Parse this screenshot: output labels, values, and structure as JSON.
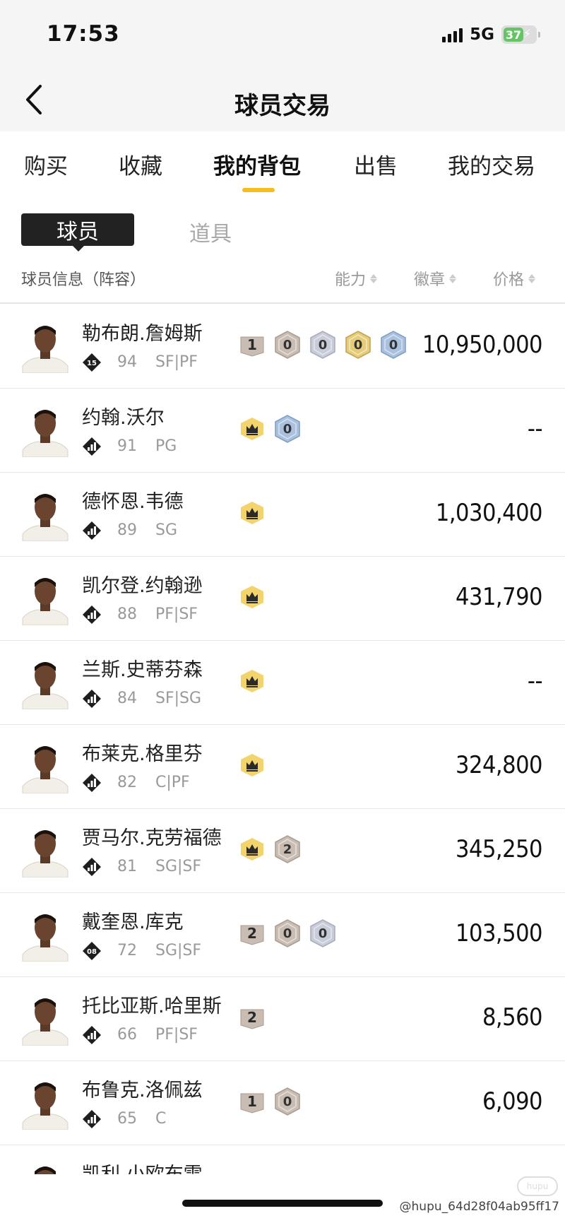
{
  "status_bar": {
    "time": "17:53",
    "network": "5G",
    "battery": "37"
  },
  "header": {
    "title": "球员交易"
  },
  "tabs": [
    {
      "label": "购买",
      "active": false
    },
    {
      "label": "收藏",
      "active": false
    },
    {
      "label": "我的背包",
      "active": true
    },
    {
      "label": "出售",
      "active": false
    },
    {
      "label": "我的交易",
      "active": false
    }
  ],
  "subtabs": {
    "player": "球员",
    "item": "道具"
  },
  "columns": {
    "info": "球员信息（阵容）",
    "ability": "能力",
    "badge": "徽章",
    "price": "价格"
  },
  "colors": {
    "accent": "#f5bd1f",
    "crown": "#f3d36b",
    "badge_tan": "#c9bcb2",
    "badge_silver": "#c8ccd8",
    "badge_gold": "#e4cc7a",
    "badge_blue": "#a9c1de"
  },
  "players": [
    {
      "name": "勒布朗.詹姆斯",
      "tier": "15",
      "ovr": "94",
      "pos": "SF|PF",
      "price": "10,950,000",
      "badges": [
        {
          "type": "square",
          "label": "1"
        },
        {
          "type": "tan",
          "label": "0"
        },
        {
          "type": "silver",
          "label": "0"
        },
        {
          "type": "gold",
          "label": "0"
        },
        {
          "type": "blue",
          "label": "0"
        }
      ]
    },
    {
      "name": "约翰.沃尔",
      "tier": "bars",
      "ovr": "91",
      "pos": "PG",
      "price": "--",
      "badges": [
        {
          "type": "crown",
          "label": ""
        },
        {
          "type": "blue",
          "label": "0"
        }
      ]
    },
    {
      "name": "德怀恩.韦德",
      "tier": "bars",
      "ovr": "89",
      "pos": "SG",
      "price": "1,030,400",
      "badges": [
        {
          "type": "crown",
          "label": ""
        }
      ]
    },
    {
      "name": "凯尔登.约翰逊",
      "tier": "bars",
      "ovr": "88",
      "pos": "PF|SF",
      "price": "431,790",
      "badges": [
        {
          "type": "crown",
          "label": ""
        }
      ]
    },
    {
      "name": "兰斯.史蒂芬森",
      "tier": "bars",
      "ovr": "84",
      "pos": "SF|SG",
      "price": "--",
      "badges": [
        {
          "type": "crown",
          "label": ""
        }
      ]
    },
    {
      "name": "布莱克.格里芬",
      "tier": "bars",
      "ovr": "82",
      "pos": "C|PF",
      "price": "324,800",
      "badges": [
        {
          "type": "crown",
          "label": ""
        }
      ]
    },
    {
      "name": "贾马尔.克劳福德",
      "tier": "bars",
      "ovr": "81",
      "pos": "SG|SF",
      "price": "345,250",
      "badges": [
        {
          "type": "crown",
          "label": ""
        },
        {
          "type": "tan",
          "label": "2"
        }
      ]
    },
    {
      "name": "戴奎恩.库克",
      "tier": "08",
      "ovr": "72",
      "pos": "SG|SF",
      "price": "103,500",
      "badges": [
        {
          "type": "square",
          "label": "2"
        },
        {
          "type": "tan",
          "label": "0"
        },
        {
          "type": "silver",
          "label": "0"
        }
      ]
    },
    {
      "name": "托比亚斯.哈里斯",
      "tier": "bars",
      "ovr": "66",
      "pos": "PF|SF",
      "price": "8,560",
      "badges": [
        {
          "type": "square",
          "label": "2"
        }
      ]
    },
    {
      "name": "布鲁克.洛佩兹",
      "tier": "bars",
      "ovr": "65",
      "pos": "C",
      "price": "6,090",
      "badges": [
        {
          "type": "square",
          "label": "1"
        },
        {
          "type": "tan",
          "label": "0"
        }
      ]
    },
    {
      "name": "凯利.小欧布雷",
      "tier": "bars",
      "ovr": "",
      "pos": "",
      "price": "",
      "badges": []
    }
  ],
  "watermark": "@hupu_64d28f04ab95ff17"
}
